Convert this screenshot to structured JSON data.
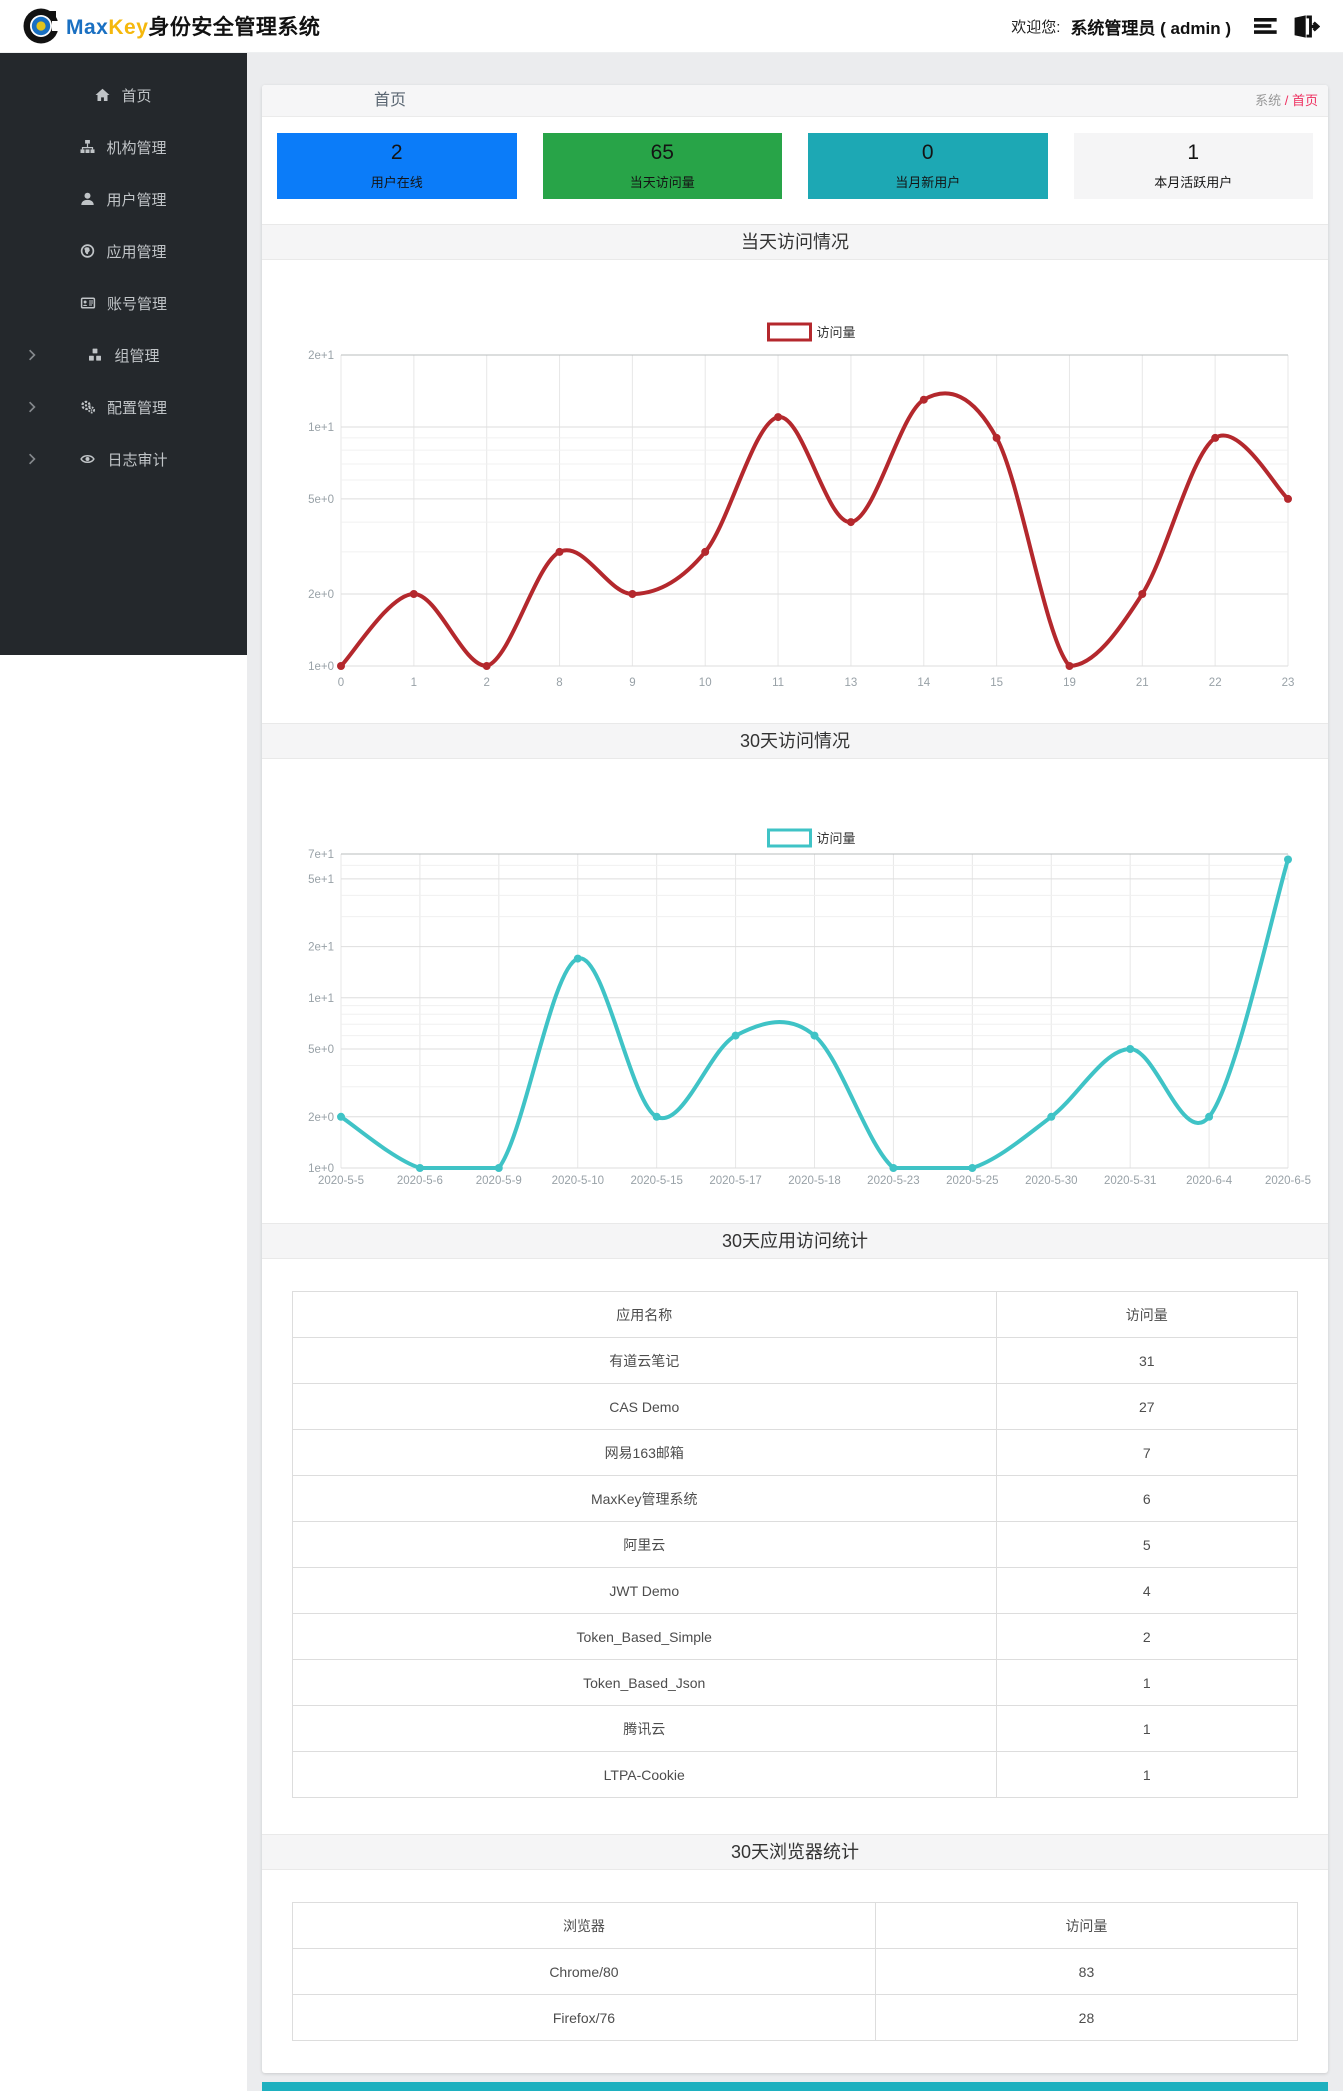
{
  "navbar": {
    "brand_max": "Max",
    "brand_key": "Key",
    "brand_rest": "身份安全管理系统",
    "welcome_label": "欢迎您:",
    "user_label": "系统管理员 ( admin )"
  },
  "sidebar": {
    "items": [
      {
        "label": "首页",
        "icon": "home-icon",
        "expandable": false
      },
      {
        "label": "机构管理",
        "icon": "sitemap-icon",
        "expandable": false
      },
      {
        "label": "用户管理",
        "icon": "user-icon",
        "expandable": false
      },
      {
        "label": "应用管理",
        "icon": "globe-icon",
        "expandable": false
      },
      {
        "label": "账号管理",
        "icon": "id-card-icon",
        "expandable": false
      },
      {
        "label": "组管理",
        "icon": "cubes-icon",
        "expandable": true
      },
      {
        "label": "配置管理",
        "icon": "gears-icon",
        "expandable": true
      },
      {
        "label": "日志审计",
        "icon": "eye-icon",
        "expandable": true
      }
    ]
  },
  "breadcrumb": {
    "title": "首页",
    "path_root": "系统",
    "path_sep": " / ",
    "path_current": "首页"
  },
  "stat_cards": [
    {
      "value": "2",
      "label": "用户在线",
      "color": "#0b7cf9"
    },
    {
      "value": "65",
      "label": "当天访问量",
      "color": "#28a448"
    },
    {
      "value": "0",
      "label": "当月新用户",
      "color": "#1da8b4"
    },
    {
      "value": "1",
      "label": "本月活跃用户",
      "color": "#f5f5f6"
    }
  ],
  "chart_data": [
    {
      "type": "line",
      "title": "当天访问情况",
      "legend": "访问量",
      "color": "#b4282d",
      "categories": [
        "0",
        "1",
        "2",
        "8",
        "9",
        "10",
        "11",
        "13",
        "14",
        "15",
        "19",
        "21",
        "22",
        "23"
      ],
      "values": [
        1,
        2,
        1,
        3,
        2,
        3,
        11,
        4,
        13,
        9,
        1,
        2,
        9,
        5
      ],
      "yscale": "log",
      "ylim": [
        1,
        20
      ],
      "yticks": [
        {
          "v": 1,
          "label": "1e+0"
        },
        {
          "v": 2,
          "label": "2e+0"
        },
        {
          "v": 5,
          "label": "5e+0"
        },
        {
          "v": 10,
          "label": "1e+1"
        },
        {
          "v": 20,
          "label": "2e+1"
        }
      ],
      "minor_gridlines": [
        3,
        4,
        6,
        7,
        8,
        9
      ],
      "grid": true,
      "legend_position": "top",
      "xlabel": "",
      "ylabel": ""
    },
    {
      "type": "line",
      "title": "30天访问情况",
      "legend": "访问量",
      "color": "#3fc3c6",
      "categories": [
        "2020-5-5",
        "2020-5-6",
        "2020-5-9",
        "2020-5-10",
        "2020-5-15",
        "2020-5-17",
        "2020-5-18",
        "2020-5-23",
        "2020-5-25",
        "2020-5-30",
        "2020-5-31",
        "2020-6-4",
        "2020-6-5"
      ],
      "values": [
        2,
        1,
        1,
        17,
        2,
        6,
        6,
        1,
        1,
        2,
        5,
        2,
        65
      ],
      "yscale": "log",
      "ylim": [
        1,
        70
      ],
      "yticks": [
        {
          "v": 1,
          "label": "1e+0"
        },
        {
          "v": 2,
          "label": "2e+0"
        },
        {
          "v": 5,
          "label": "5e+0"
        },
        {
          "v": 10,
          "label": "1e+1"
        },
        {
          "v": 20,
          "label": "2e+1"
        },
        {
          "v": 50,
          "label": "5e+1"
        },
        {
          "v": 70,
          "label": "7e+1"
        }
      ],
      "minor_gridlines": [
        3,
        4,
        6,
        7,
        8,
        9,
        30,
        40,
        60
      ],
      "grid": true,
      "legend_position": "top",
      "xlabel": "",
      "ylabel": ""
    }
  ],
  "tables": [
    {
      "title": "30天应用访问统计",
      "headers": [
        "应用名称",
        "访问量"
      ],
      "rows": [
        [
          "有道云笔记",
          "31"
        ],
        [
          "CAS Demo",
          "27"
        ],
        [
          "网易163邮箱",
          "7"
        ],
        [
          "MaxKey管理系统",
          "6"
        ],
        [
          "阿里云",
          "5"
        ],
        [
          "JWT Demo",
          "4"
        ],
        [
          "Token_Based_Simple",
          "2"
        ],
        [
          "Token_Based_Json",
          "1"
        ],
        [
          "腾讯云",
          "1"
        ],
        [
          "LTPA-Cookie",
          "1"
        ]
      ]
    },
    {
      "title": "30天浏览器统计",
      "headers": [
        "浏览器",
        "访问量"
      ],
      "rows": [
        [
          "Chrome/80",
          "83"
        ],
        [
          "Firefox/76",
          "28"
        ]
      ]
    }
  ],
  "footer_accent_color": "#1db0bf"
}
